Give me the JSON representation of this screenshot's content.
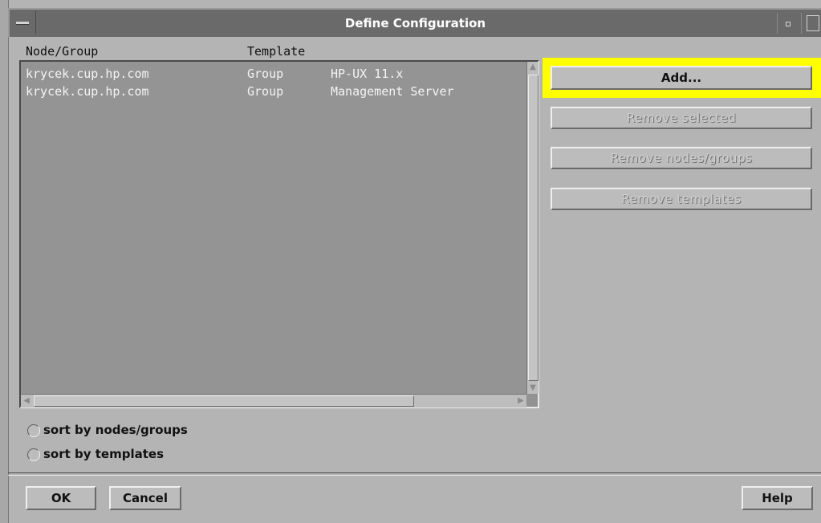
{
  "window": {
    "title": "Define Configuration"
  },
  "list": {
    "headers": [
      "Node/Group",
      "Template"
    ],
    "rows": [
      {
        "node": "krycek.cup.hp.com",
        "type": "Group",
        "template": "HP-UX 11.x"
      },
      {
        "node": "krycek.cup.hp.com",
        "type": "Group",
        "template": "Management Server"
      }
    ]
  },
  "actions": {
    "add": "Add...",
    "remove_selected": "Remove selected",
    "remove_nodes_groups": "Remove nodes/groups",
    "remove_templates": "Remove templates"
  },
  "sort": {
    "by_nodes": "sort by nodes/groups",
    "by_templates": "sort by templates"
  },
  "footer": {
    "ok": "OK",
    "cancel": "Cancel",
    "help": "Help"
  },
  "colors": {
    "highlight": "#ffff00",
    "titlebar": "#6a6a6a",
    "list_bg": "#949494",
    "window_bg": "#b4b4b4"
  },
  "icons": [
    "window-menu-icon",
    "minimize-icon",
    "maximize-icon",
    "scroll-up-arrow-icon",
    "scroll-down-arrow-icon",
    "scroll-left-arrow-icon",
    "scroll-right-arrow-icon"
  ]
}
